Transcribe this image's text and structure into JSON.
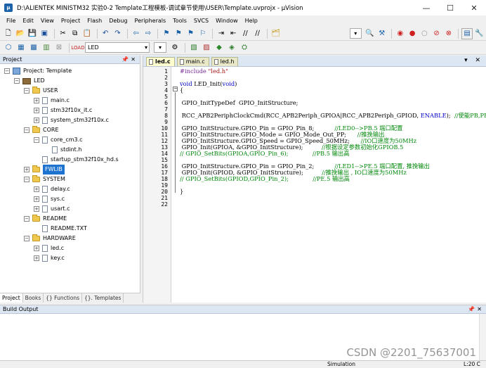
{
  "window": {
    "title": "D:\\ALIENTEK MINISTM32 实验0-2 Template工程模板-调试章节使用\\USER\\Template.uvprojx - µVision",
    "app_icon": "uv-icon"
  },
  "menu": [
    "File",
    "Edit",
    "View",
    "Project",
    "Flash",
    "Debug",
    "Peripherals",
    "Tools",
    "SVCS",
    "Window",
    "Help"
  ],
  "toolbar2": {
    "target": "LED"
  },
  "project_panel": {
    "title": "Project",
    "tree": [
      {
        "label": "Project: Template",
        "kind": "project",
        "level": 0,
        "expander": "−"
      },
      {
        "label": "LED",
        "kind": "target",
        "level": 1,
        "expander": "−"
      },
      {
        "label": "USER",
        "kind": "folder",
        "level": 2,
        "expander": "−"
      },
      {
        "label": "main.c",
        "kind": "file",
        "level": 3,
        "expander": "+"
      },
      {
        "label": "stm32f10x_it.c",
        "kind": "file",
        "level": 3,
        "expander": "+"
      },
      {
        "label": "system_stm32f10x.c",
        "kind": "file",
        "level": 3,
        "expander": "+"
      },
      {
        "label": "CORE",
        "kind": "folder",
        "level": 2,
        "expander": "−"
      },
      {
        "label": "core_cm3.c",
        "kind": "file",
        "level": 3,
        "expander": "−"
      },
      {
        "label": "stdint.h",
        "kind": "file",
        "level": 4,
        "expander": ""
      },
      {
        "label": "startup_stm32f10x_hd.s",
        "kind": "file",
        "level": 3,
        "expander": ""
      },
      {
        "label": "FWLIB",
        "kind": "folder",
        "level": 2,
        "expander": "+",
        "selected": true
      },
      {
        "label": "SYSTEM",
        "kind": "folder",
        "level": 2,
        "expander": "−"
      },
      {
        "label": "delay.c",
        "kind": "file",
        "level": 3,
        "expander": "+"
      },
      {
        "label": "sys.c",
        "kind": "file",
        "level": 3,
        "expander": "+"
      },
      {
        "label": "usart.c",
        "kind": "file",
        "level": 3,
        "expander": "+"
      },
      {
        "label": "README",
        "kind": "folder",
        "level": 2,
        "expander": "−"
      },
      {
        "label": "README.TXT",
        "kind": "file",
        "level": 3,
        "expander": ""
      },
      {
        "label": "HARDWARE",
        "kind": "folder",
        "level": 2,
        "expander": "−"
      },
      {
        "label": "led.c",
        "kind": "file",
        "level": 3,
        "expander": "+"
      },
      {
        "label": "key.c",
        "kind": "file",
        "level": 3,
        "expander": "+"
      }
    ],
    "tabs": [
      "Project",
      "Books",
      "{} Functions",
      "{}. Templates"
    ]
  },
  "editor": {
    "tabs": [
      {
        "label": "led.c",
        "active": true
      },
      {
        "label": "main.c",
        "active": false
      },
      {
        "label": "led.h",
        "active": false
      }
    ],
    "lines": [
      "#include \"led.h\"",
      "",
      "void LED_Init(void)",
      "{",
      "",
      " GPIO_InitTypeDef  GPIO_InitStructure;",
      "",
      " RCC_APB2PeriphClockCmd(RCC_APB2Periph_GPIOA|RCC_APB2Periph_GPIOD, ENABLE);  //使能PB,PE端",
      "",
      " GPIO_InitStructure.GPIO_Pin = GPIO_Pin_8;           //LED0-->PB.5 端口配置",
      " GPIO_InitStructure.GPIO_Mode = GPIO_Mode_Out_PP;      //推挽输出",
      " GPIO_InitStructure.GPIO_Speed = GPIO_Speed_50MHz;      //IO口速度为50MHz",
      " GPIO_Init(GPIOA, &GPIO_InitStructure);          //根据设定参数初始化GPIOB.5",
      "// GPIO_SetBits(GPIOA,GPIO_Pin_6);             //PB.5 输出高",
      "",
      " GPIO_InitStructure.GPIO_Pin = GPIO_Pin_2;           //LED1-->PE.5 端口配置, 推挽输出",
      " GPIO_Init(GPIOD, &GPIO_InitStructure);          //推挽输出 , IO口速度为50MHz",
      "// GPIO_SetBits(GPIOD,GPIO_Pin_2);             //PE.5 输出高",
      "",
      "}",
      "",
      ""
    ]
  },
  "build_output": {
    "title": "Build Output"
  },
  "status": {
    "mode": "Simulation",
    "position": "L:20 C"
  },
  "watermark": "CSDN @2201_75637001",
  "colors": {
    "keyword": "#0000c8",
    "string": "#a31515",
    "comment": "#00880a",
    "preprocessor": "#7a2c9a",
    "selection": "#1e73d0"
  }
}
